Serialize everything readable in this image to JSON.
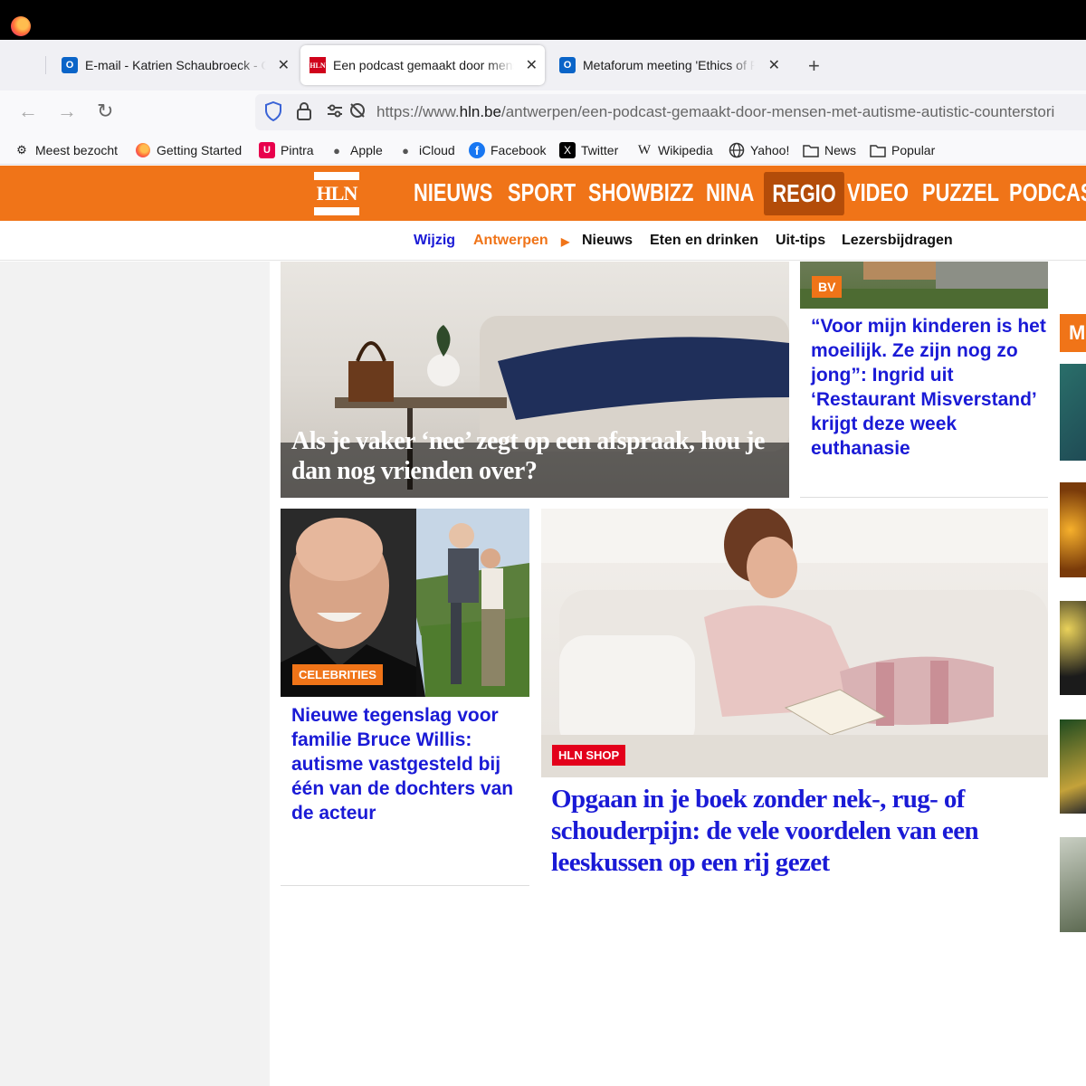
{
  "browser": {
    "tabs": [
      {
        "title": "E-mail - Katrien Schaubroeck - Outlook",
        "icon": "outlook-icon"
      },
      {
        "title": "Een podcast gemaakt door mensen met autisme",
        "icon": "hln-favicon"
      },
      {
        "title": "Metaforum meeting 'Ethics of Re",
        "icon": "outlook-icon"
      }
    ],
    "url_scheme": "https://www.",
    "url_host": "hln.be",
    "url_path": "/antwerpen/een-podcast-gemaakt-door-mensen-met-autisme-autistic-counterstori",
    "bookmarks": [
      "Meest bezocht",
      "Getting Started",
      "Pintra",
      "Apple",
      "iCloud",
      "Facebook",
      "Twitter",
      "Wikipedia",
      "Yahoo!",
      "News",
      "Popular"
    ]
  },
  "site": {
    "logo": "HLN",
    "main_nav": [
      "NIEUWS",
      "SPORT",
      "SHOWBIZZ",
      "NINA",
      "REGIO",
      "VIDEO",
      "PUZZEL",
      "PODCAST"
    ],
    "active_nav": "REGIO",
    "sub_nav": {
      "wijzig": "Wijzig",
      "region": "Antwerpen",
      "arrow": "▶",
      "items": [
        "Nieuws",
        "Eten en drinken",
        "Uit-tips",
        "Lezersbijdragen"
      ]
    },
    "right_edge_chip": "M"
  },
  "articles": {
    "top_left": {
      "headline": "Als je vaker ‘nee’ zegt op een afspraak, hou je dan nog vrienden over?"
    },
    "top_right": {
      "chip": "BV",
      "headline": "“Voor mijn kinderen is het moeilijk. Ze zijn nog zo jong”: Ingrid uit ‘Restaurant Misverstand’ krijgt deze week euthanasie"
    },
    "bottom_left": {
      "chip": "CELEBRITIES",
      "headline": "Nieuwe tegenslag voor familie Bruce Willis: autisme vastgesteld bij één van de dochters van de acteur"
    },
    "bottom_right": {
      "chip": "HLN SHOP",
      "headline": "Opgaan in je boek zonder nek-, rug- of schouderpijn: de vele voordelen van een leeskussen op een rij gezet"
    }
  },
  "colors": {
    "brand_orange": "#f07418",
    "link_blue": "#1a1ad6",
    "shop_red": "#e3001b"
  }
}
